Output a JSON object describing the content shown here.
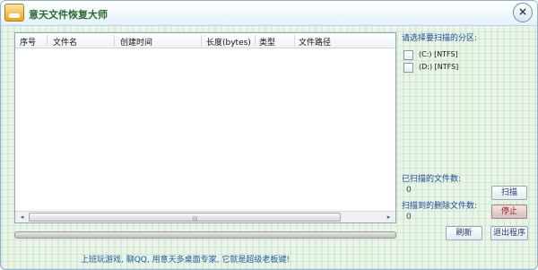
{
  "window": {
    "title": "意天文件恢复大师",
    "close_label": "×"
  },
  "table": {
    "columns": [
      "序号",
      "文件名",
      "创建时间",
      "长度(bytes)",
      "类型",
      "文件路径"
    ],
    "rows": []
  },
  "scrollbar": {
    "left_arrow": "◂",
    "right_arrow": "▸",
    "grip": "|||"
  },
  "sidebar": {
    "partition_prompt": "请选择要扫描的分区:",
    "partitions": [
      {
        "label": "(C:)  [NTFS]",
        "checked": false
      },
      {
        "label": "(D:)  [NTFS]",
        "checked": false
      }
    ],
    "scanned_files_label": "已扫描的文件数:",
    "scanned_files_value": "0",
    "deleted_files_label": "扫描到的删除文件数:",
    "deleted_files_value": "0"
  },
  "buttons": {
    "scan": "扫描",
    "stop": "停止",
    "refresh": "刷新",
    "exit": "退出程序"
  },
  "progress": {
    "value": 0
  },
  "footer": {
    "ad_text": "上班玩游戏, 聊QQ, 用意天多桌面专家, 它就是超级老板键!"
  }
}
